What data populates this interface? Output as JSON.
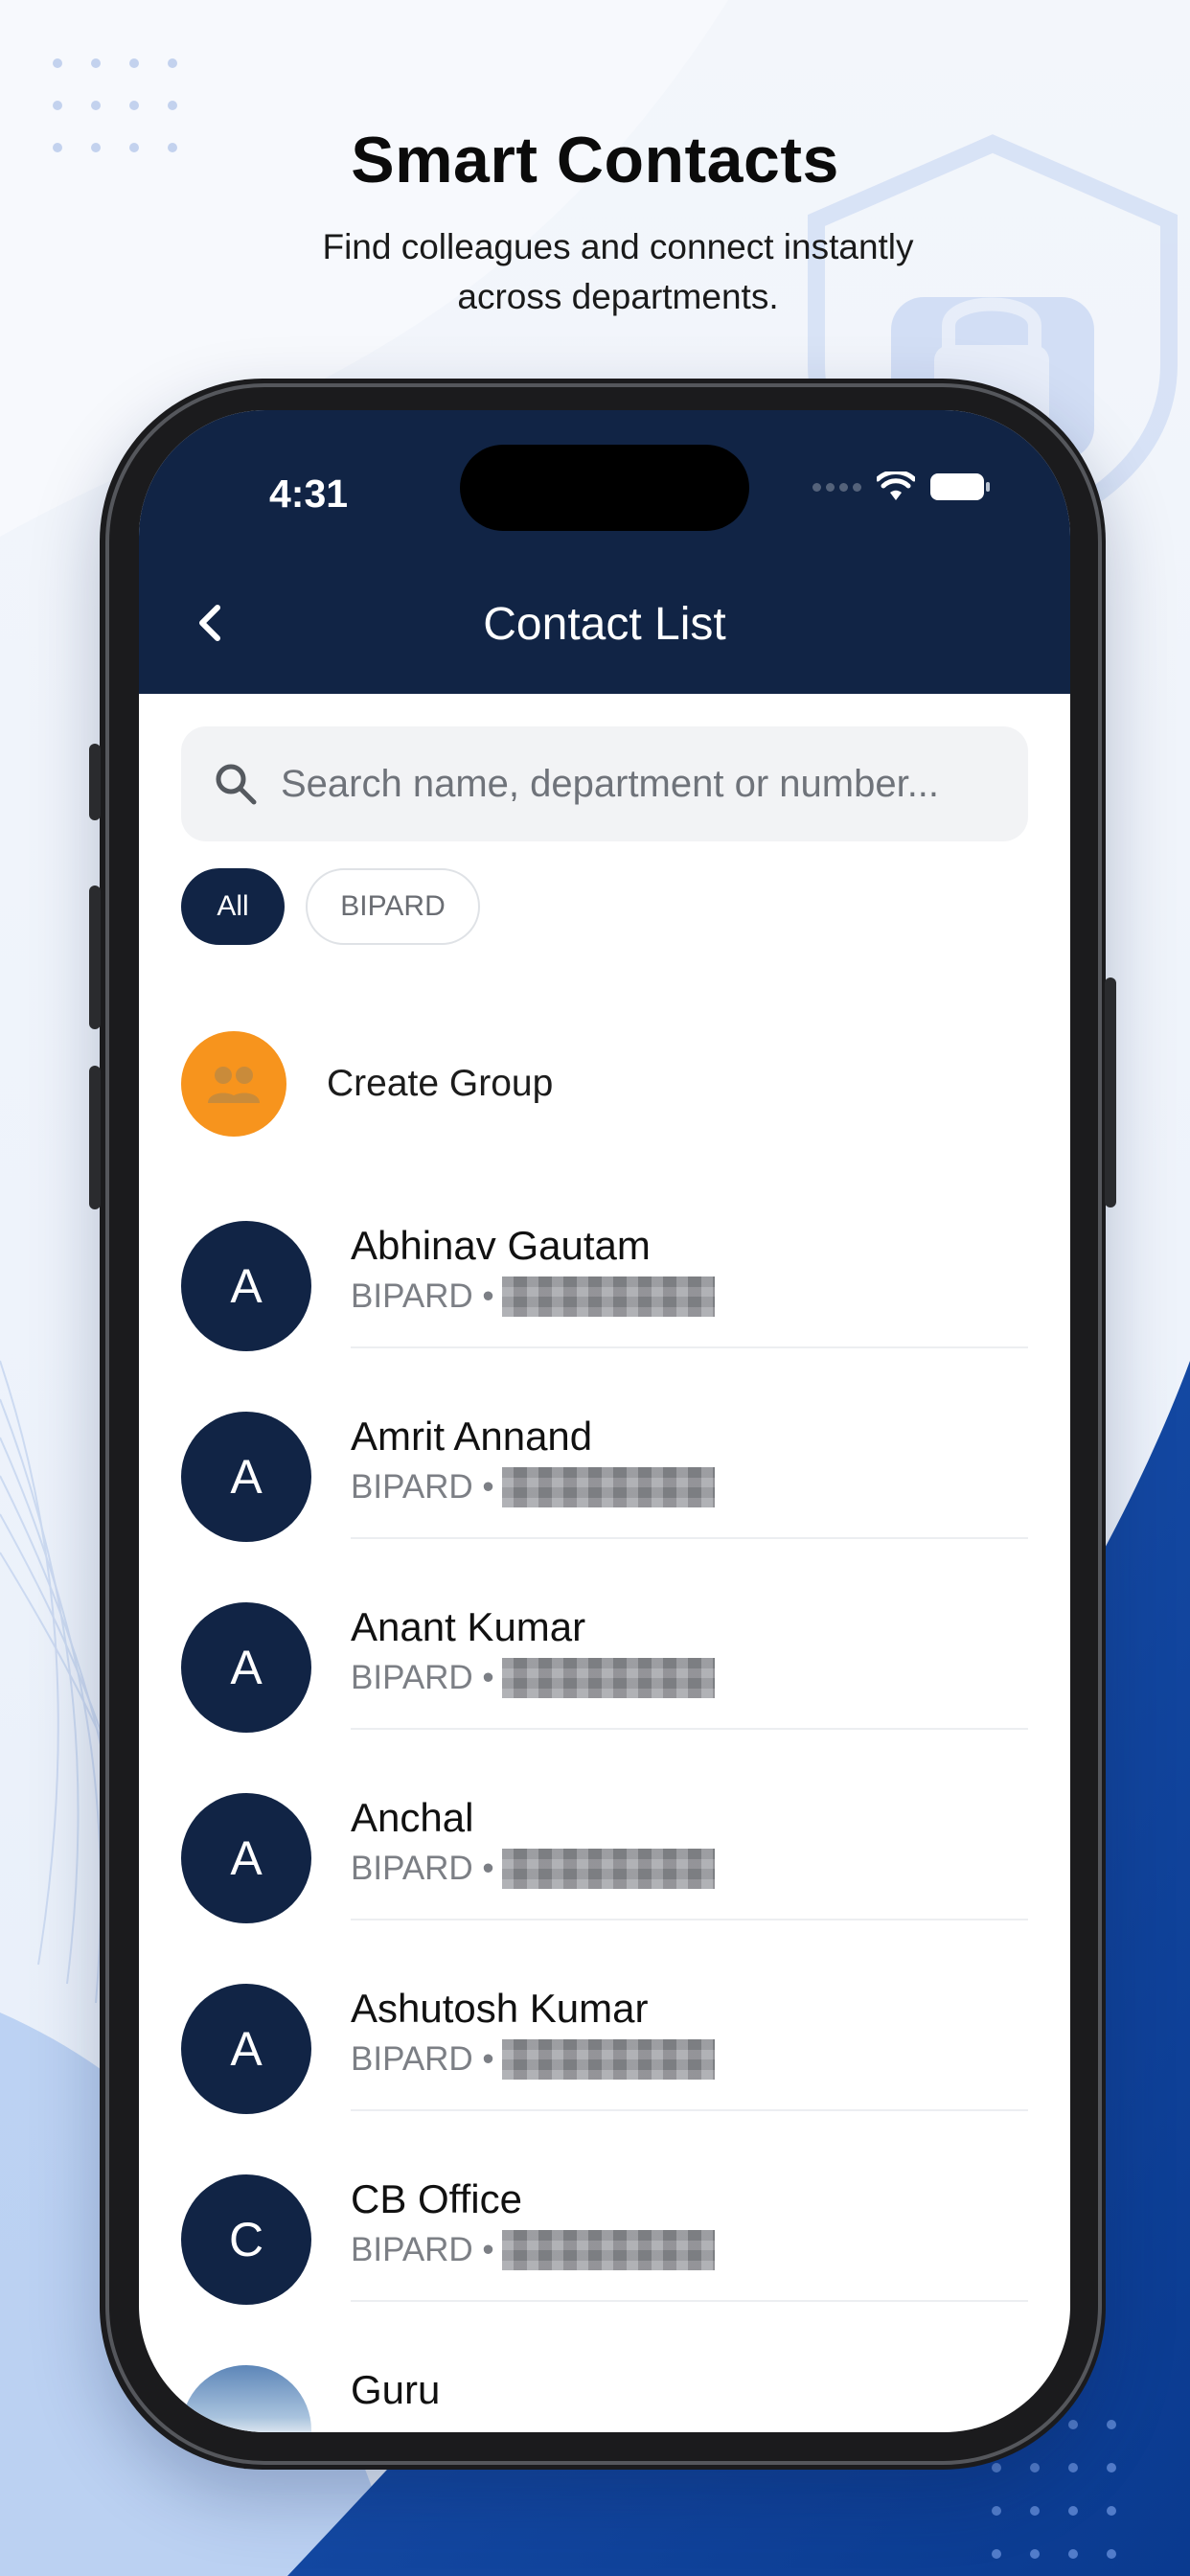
{
  "promo": {
    "headline": "Smart Contacts",
    "subheadline": "Find colleagues and connect instantly across departments."
  },
  "status_bar": {
    "time": "4:31",
    "icons": [
      "cellular-signal-icon",
      "wifi-icon",
      "battery-icon"
    ]
  },
  "header": {
    "title": "Contact List",
    "back_icon": "chevron-left-icon"
  },
  "search": {
    "placeholder": "Search name, department or number...",
    "value": ""
  },
  "filters": {
    "chips": [
      {
        "label": "All",
        "selected": true
      },
      {
        "label": "BIPARD",
        "selected": false
      }
    ]
  },
  "create_group": {
    "label": "Create Group",
    "icon": "group-icon",
    "color": "#f7941d"
  },
  "contacts": [
    {
      "initial": "A",
      "name": "Abhinav Gautam",
      "department": "BIPARD •"
    },
    {
      "initial": "A",
      "name": "Amrit Annand",
      "department": "BIPARD •"
    },
    {
      "initial": "A",
      "name": "Anant Kumar",
      "department": "BIPARD •"
    },
    {
      "initial": "A",
      "name": "Anchal",
      "department": "BIPARD •"
    },
    {
      "initial": "A",
      "name": "Ashutosh Kumar",
      "department": "BIPARD •"
    },
    {
      "initial": "C",
      "name": "CB Office",
      "department": "BIPARD •"
    },
    {
      "initial": "",
      "name": "Guru",
      "department": ""
    }
  ],
  "colors": {
    "navy": "#112445",
    "accent_orange": "#f7941d",
    "background": "#eef3fb"
  }
}
